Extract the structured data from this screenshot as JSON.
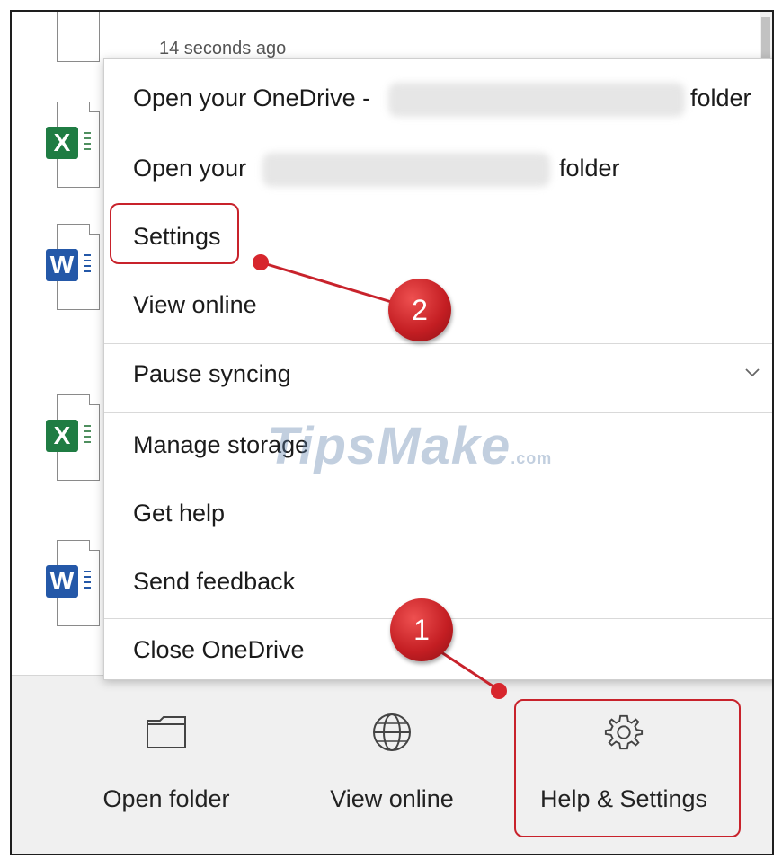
{
  "recent_activity": {
    "time_label": "14 seconds ago",
    "files": [
      {
        "type": "excel",
        "badge": "X",
        "color": "#1f7c43"
      },
      {
        "type": "word",
        "badge": "W",
        "color": "#2458a8"
      },
      {
        "type": "excel",
        "badge": "X",
        "color": "#1f7c43"
      },
      {
        "type": "word",
        "badge": "W",
        "color": "#2458a8"
      }
    ]
  },
  "menu": {
    "open_onedrive_prefix": "Open your OneDrive -",
    "open_onedrive_suffix": "folder",
    "open_other_prefix": "Open your",
    "open_other_suffix": "folder",
    "settings": "Settings",
    "view_online": "View online",
    "pause_syncing": "Pause syncing",
    "manage_storage": "Manage storage",
    "get_help": "Get help",
    "send_feedback": "Send feedback",
    "close_onedrive": "Close OneDrive"
  },
  "bottom_bar": {
    "open_folder": "Open folder",
    "view_online": "View online",
    "help_settings": "Help & Settings"
  },
  "annotations": {
    "marker_1": "1",
    "marker_2": "2",
    "accent_color": "#c8222b"
  },
  "watermark": {
    "text": "TipsMake",
    "suffix": ".com"
  },
  "icons": [
    "folder-icon",
    "globe-icon",
    "gear-icon",
    "chevron-down-icon"
  ]
}
